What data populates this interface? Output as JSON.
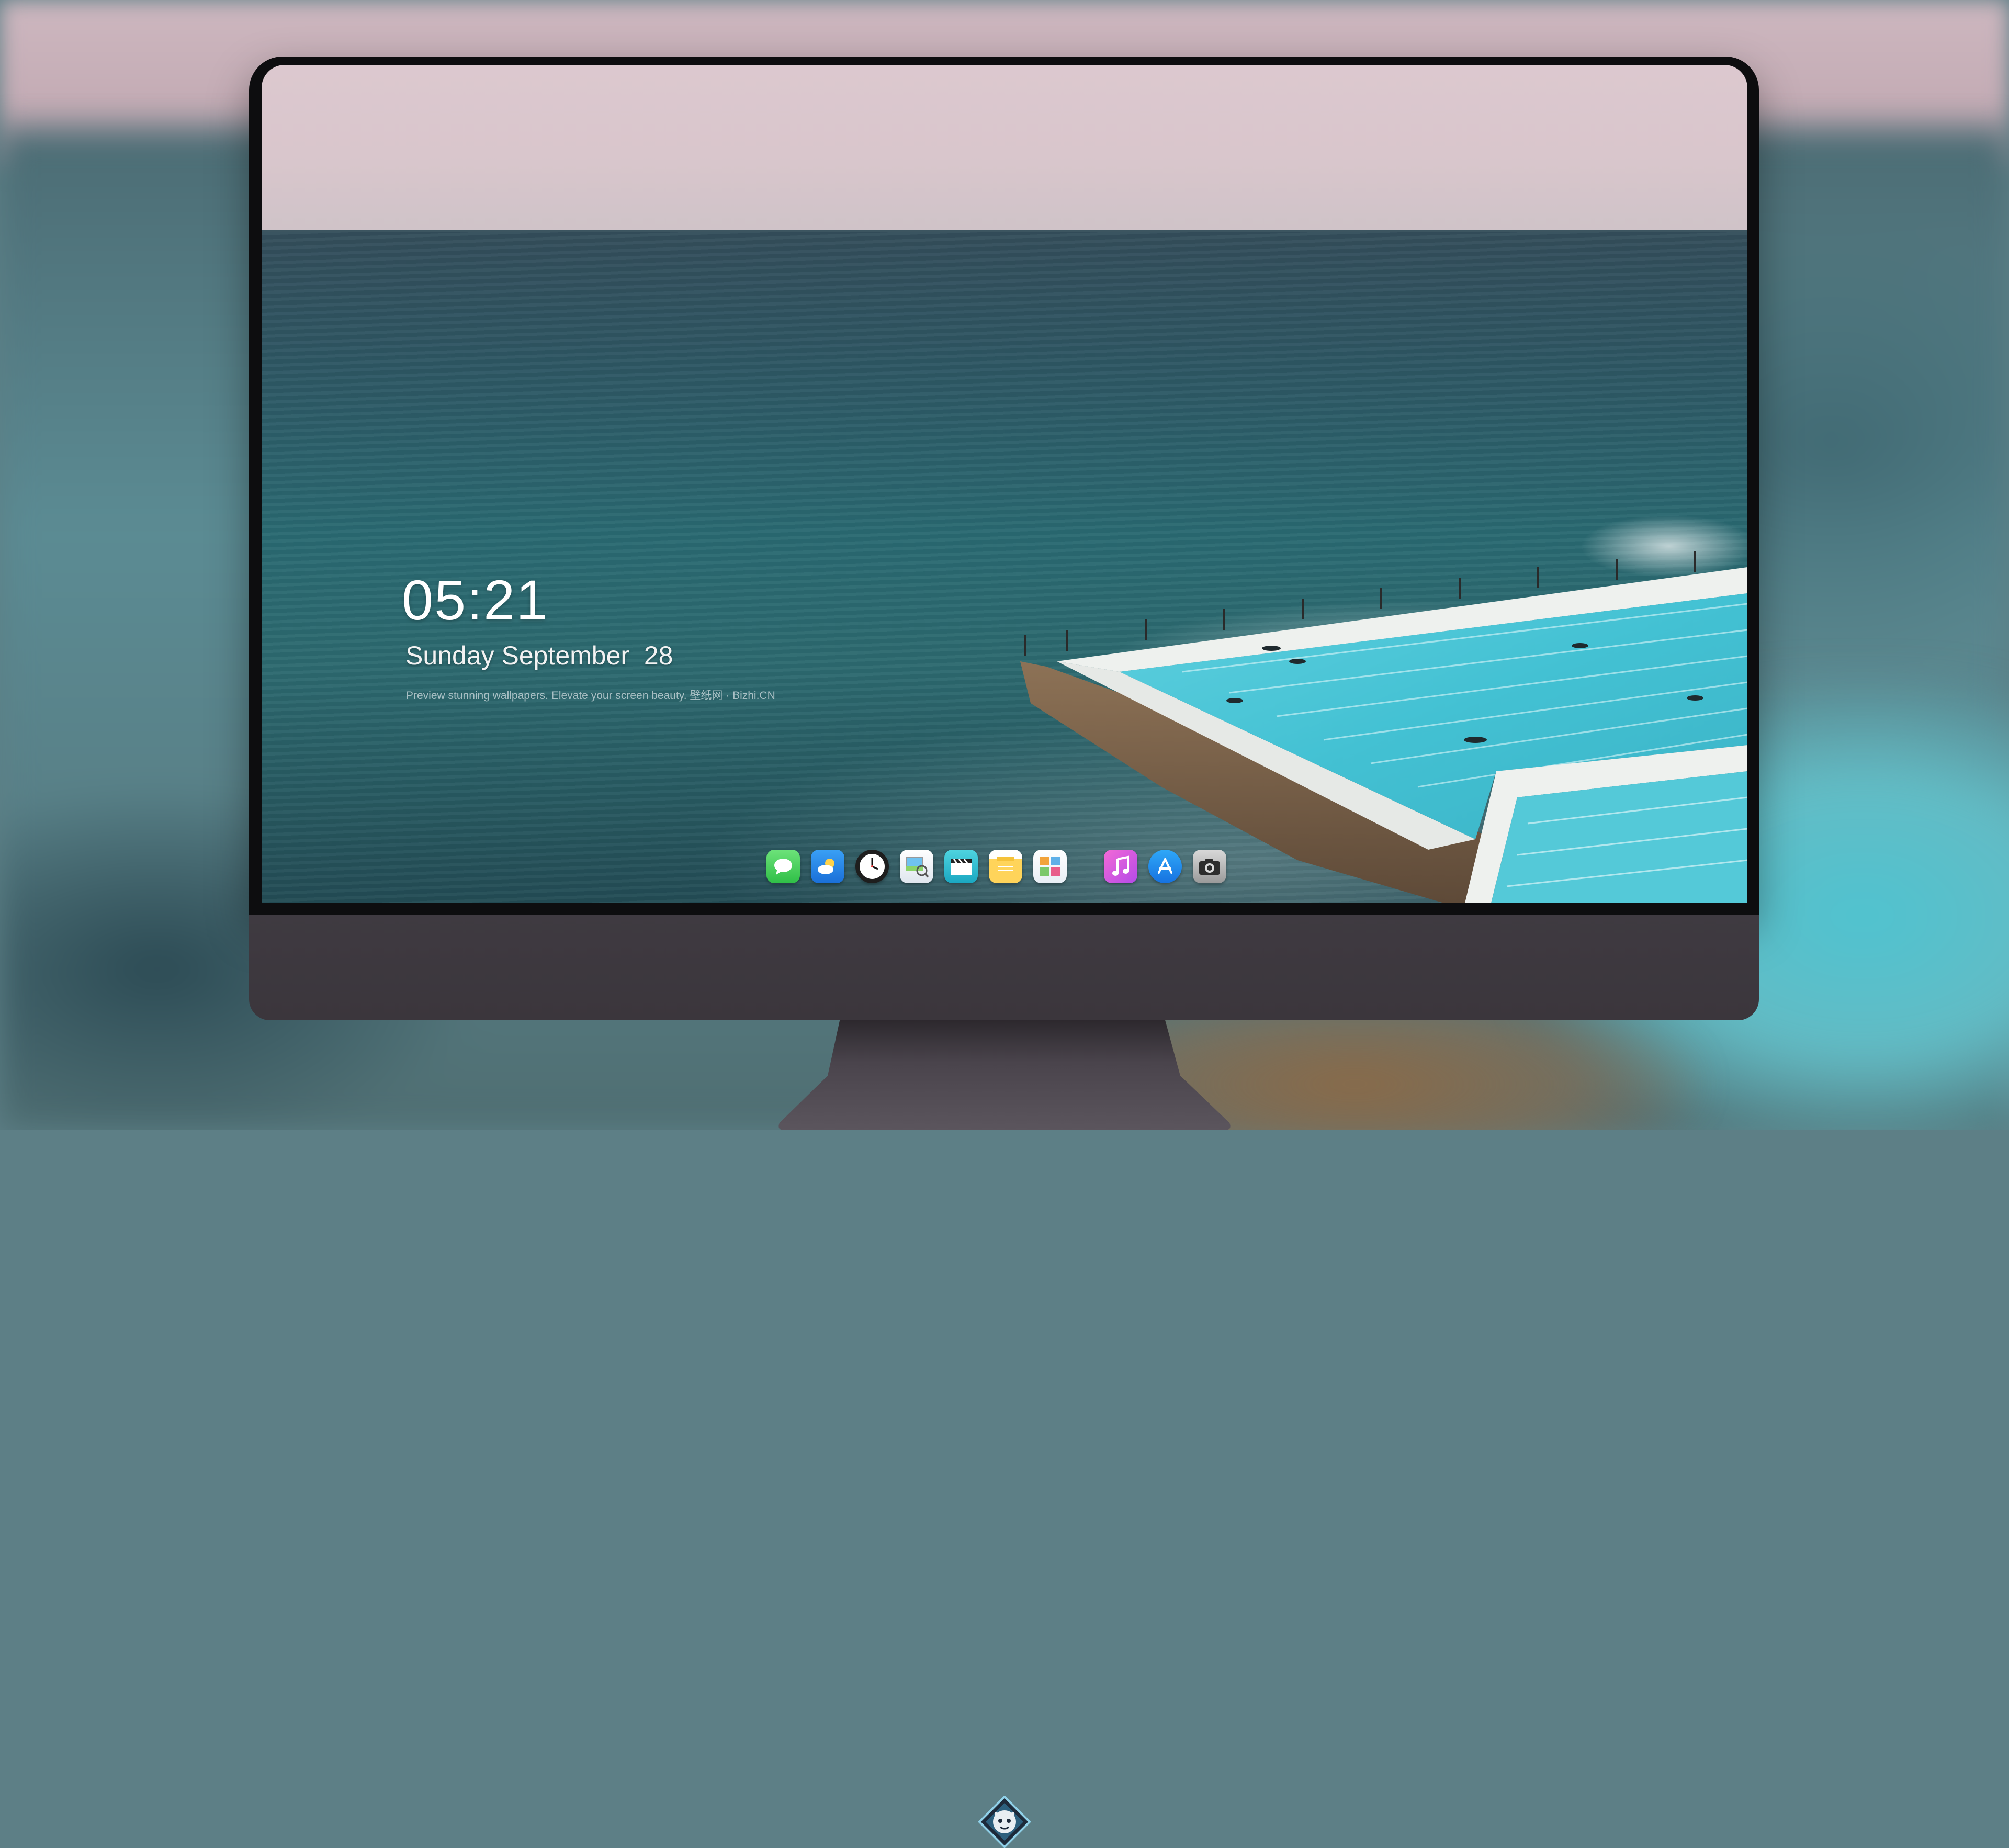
{
  "lockscreen": {
    "time": "05:21",
    "date": "Sunday September  28",
    "caption": "Preview stunning wallpapers. Elevate your screen beauty. 壁纸网 · Bizhi.CN"
  },
  "dock": {
    "apps": [
      {
        "name": "messages-icon"
      },
      {
        "name": "weather-icon"
      },
      {
        "name": "clock-icon"
      },
      {
        "name": "preview-icon"
      },
      {
        "name": "clapper-icon"
      },
      {
        "name": "notes-icon"
      },
      {
        "name": "photo-booth-icon"
      },
      {
        "name": "music-icon"
      },
      {
        "name": "app-store-icon"
      },
      {
        "name": "camera-icon"
      }
    ]
  },
  "colors": {
    "bezel": "#0d0d0f",
    "chin": "#3d383f",
    "sky": "#dac7cd",
    "sea": "#2b5f69",
    "pool": "#43c1d3"
  }
}
